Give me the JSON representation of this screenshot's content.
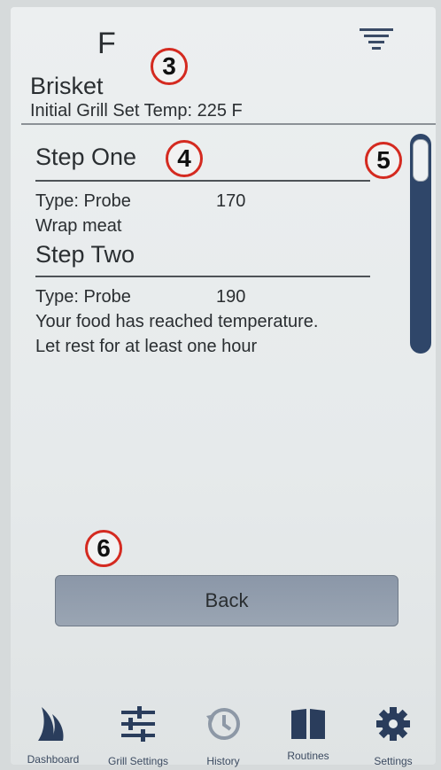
{
  "header": {
    "unit": "F",
    "recipe_name": "Brisket",
    "initial_grill_set_temp": "Initial Grill Set Temp: 225 F"
  },
  "annotations": [
    "3",
    "4",
    "5",
    "6"
  ],
  "steps": [
    {
      "title": "Step One",
      "type": "Type: Probe",
      "temp": "170",
      "notes": [
        "Wrap meat"
      ]
    },
    {
      "title": "Step Two",
      "type": "Type: Probe",
      "temp": "190",
      "notes": [
        "Your food has reached temperature.",
        "Let rest for at least one hour"
      ]
    }
  ],
  "back_label": "Back",
  "nav": [
    {
      "label": "Dashboard",
      "icon": "sail-icon"
    },
    {
      "label": "Grill Settings",
      "icon": "sliders-icon"
    },
    {
      "label": "History",
      "icon": "history-icon"
    },
    {
      "label": "Routines",
      "icon": "book-icon"
    },
    {
      "label": "Settings",
      "icon": "gear-icon"
    }
  ],
  "colors": {
    "accent": "#2f4669",
    "button": "#9aa5b3",
    "badge_ring": "#d42a20"
  }
}
